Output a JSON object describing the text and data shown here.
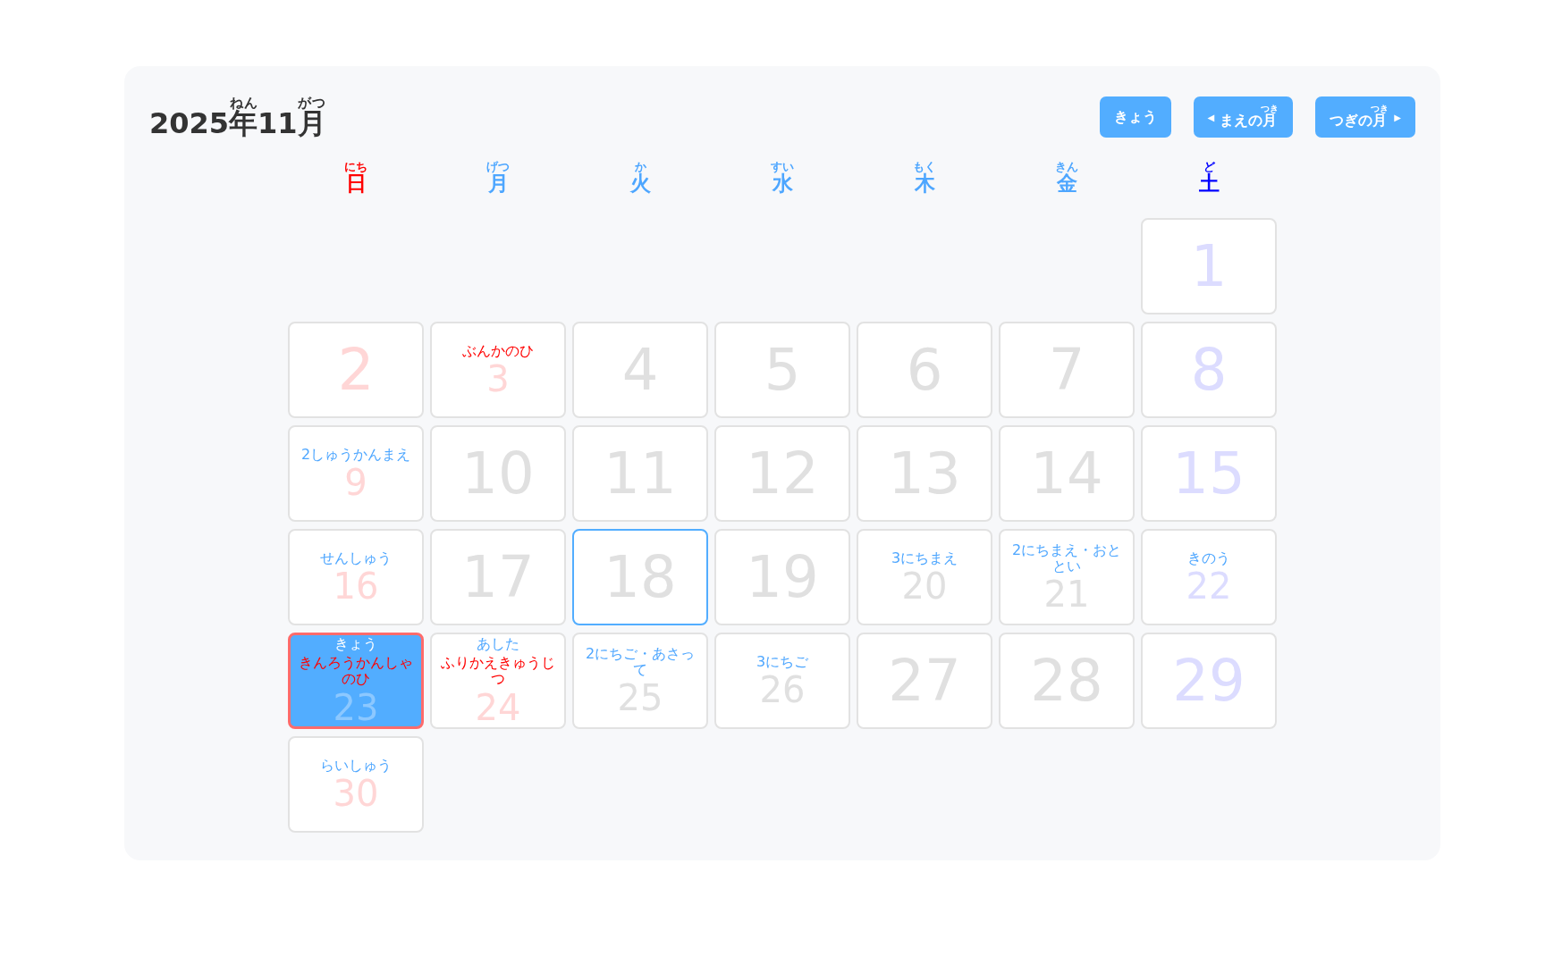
{
  "title": [
    {
      "text": "2025"
    },
    {
      "text": "年",
      "ruby": "ねん"
    },
    {
      "text": "11"
    },
    {
      "text": "月",
      "ruby": "がつ"
    }
  ],
  "buttons": [
    {
      "kind": "today",
      "parts": [
        {
          "text": "きょう"
        }
      ]
    },
    {
      "kind": "prev",
      "arrow": "◀",
      "parts": [
        {
          "text": "まえの"
        },
        {
          "text": "月",
          "ruby": "つき"
        }
      ]
    },
    {
      "kind": "next",
      "arrow": "▶",
      "parts": [
        {
          "text": "つぎの"
        },
        {
          "text": "月",
          "ruby": "つき"
        }
      ]
    }
  ],
  "weekdays": [
    {
      "text": "日",
      "ruby": "にち",
      "color": "#ff0000"
    },
    {
      "text": "月",
      "ruby": "げつ",
      "color": "#4da6ff"
    },
    {
      "text": "火",
      "ruby": "か",
      "color": "#4da6ff"
    },
    {
      "text": "水",
      "ruby": "すい",
      "color": "#4da6ff"
    },
    {
      "text": "木",
      "ruby": "もく",
      "color": "#4da6ff"
    },
    {
      "text": "金",
      "ruby": "きん",
      "color": "#4da6ff"
    },
    {
      "text": "土",
      "ruby": "ど",
      "color": "#0000ff"
    }
  ],
  "weeks": [
    [
      {
        "kind": "empty"
      },
      {
        "kind": "empty"
      },
      {
        "kind": "empty"
      },
      {
        "kind": "empty"
      },
      {
        "kind": "empty"
      },
      {
        "kind": "empty"
      },
      {
        "day": "1",
        "kind": "saturday",
        "selected": false,
        "today": false
      }
    ],
    [
      {
        "day": "2",
        "kind": "sunday",
        "selected": false,
        "today": false
      },
      {
        "day": "3",
        "kind": "holiday",
        "selected": false,
        "today": false,
        "labels": [
          {
            "text": "ぶんかのひ",
            "kind": "holiday"
          }
        ]
      },
      {
        "day": "4",
        "kind": "weekday",
        "selected": false,
        "today": false
      },
      {
        "day": "5",
        "kind": "weekday",
        "selected": false,
        "today": false
      },
      {
        "day": "6",
        "kind": "weekday",
        "selected": false,
        "today": false
      },
      {
        "day": "7",
        "kind": "weekday",
        "selected": false,
        "today": false
      },
      {
        "day": "8",
        "kind": "saturday",
        "selected": false,
        "today": false
      }
    ],
    [
      {
        "day": "9",
        "kind": "sunday",
        "selected": false,
        "today": false,
        "labels": [
          {
            "text": "2しゅうかんまえ",
            "kind": "relative"
          }
        ]
      },
      {
        "day": "10",
        "kind": "weekday",
        "selected": false,
        "today": false
      },
      {
        "day": "11",
        "kind": "weekday",
        "selected": false,
        "today": false
      },
      {
        "day": "12",
        "kind": "weekday",
        "selected": false,
        "today": false
      },
      {
        "day": "13",
        "kind": "weekday",
        "selected": false,
        "today": false
      },
      {
        "day": "14",
        "kind": "weekday",
        "selected": false,
        "today": false
      },
      {
        "day": "15",
        "kind": "saturday",
        "selected": false,
        "today": false
      }
    ],
    [
      {
        "day": "16",
        "kind": "sunday",
        "selected": false,
        "today": false,
        "labels": [
          {
            "text": "せんしゅう",
            "kind": "relative"
          }
        ]
      },
      {
        "day": "17",
        "kind": "weekday",
        "selected": false,
        "today": false
      },
      {
        "day": "18",
        "kind": "weekday",
        "selected": true,
        "today": false
      },
      {
        "day": "19",
        "kind": "weekday",
        "selected": false,
        "today": false
      },
      {
        "day": "20",
        "kind": "weekday",
        "selected": false,
        "today": false,
        "labels": [
          {
            "text": "3にちまえ",
            "kind": "relative"
          }
        ]
      },
      {
        "day": "21",
        "kind": "weekday",
        "selected": false,
        "today": false,
        "labels": [
          {
            "text": "2にちまえ・おととい",
            "kind": "relative"
          }
        ]
      },
      {
        "day": "22",
        "kind": "saturday",
        "selected": false,
        "today": false,
        "labels": [
          {
            "text": "きのう",
            "kind": "relative"
          }
        ]
      }
    ],
    [
      {
        "day": "23",
        "kind": "holiday",
        "selected": false,
        "today": true,
        "labels": [
          {
            "text": "きょう",
            "kind": "relative"
          },
          {
            "text": "きんろうかんしゃのひ",
            "kind": "holiday"
          }
        ]
      },
      {
        "day": "24",
        "kind": "holiday",
        "selected": false,
        "today": false,
        "labels": [
          {
            "text": "あした",
            "kind": "relative"
          },
          {
            "text": "ふりかえきゅうじつ",
            "kind": "holiday"
          }
        ]
      },
      {
        "day": "25",
        "kind": "weekday",
        "selected": false,
        "today": false,
        "labels": [
          {
            "text": "2にちご・あさって",
            "kind": "relative"
          }
        ]
      },
      {
        "day": "26",
        "kind": "weekday",
        "selected": false,
        "today": false,
        "labels": [
          {
            "text": "3にちご",
            "kind": "relative"
          }
        ]
      },
      {
        "day": "27",
        "kind": "weekday",
        "selected": false,
        "today": false
      },
      {
        "day": "28",
        "kind": "weekday",
        "selected": false,
        "today": false
      },
      {
        "day": "29",
        "kind": "saturday",
        "selected": false,
        "today": false
      }
    ],
    [
      {
        "day": "30",
        "kind": "sunday",
        "selected": false,
        "today": false,
        "labels": [
          {
            "text": "らいしゅう",
            "kind": "relative"
          }
        ]
      },
      {
        "kind": "empty"
      },
      {
        "kind": "empty"
      },
      {
        "kind": "empty"
      },
      {
        "kind": "empty"
      },
      {
        "kind": "empty"
      },
      {
        "kind": "empty"
      }
    ]
  ]
}
